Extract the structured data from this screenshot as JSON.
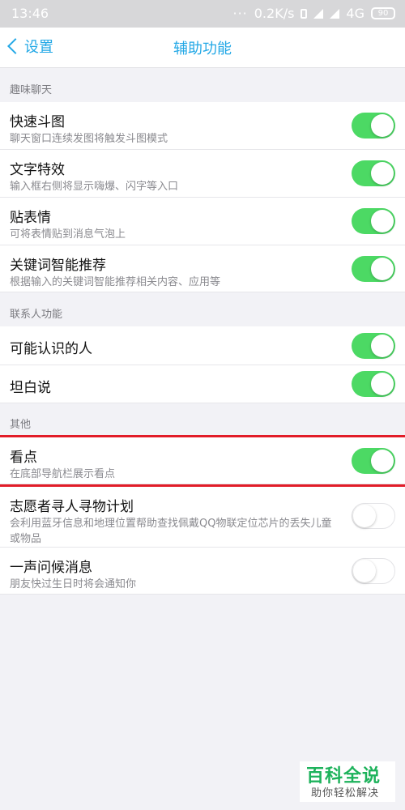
{
  "status": {
    "time": "13:46",
    "dots": "···",
    "speed": "0.2K/s",
    "network": "4G",
    "battery": "90"
  },
  "nav": {
    "back_label": "设置",
    "title": "辅助功能"
  },
  "sections": [
    {
      "header": "趣味聊天",
      "items": [
        {
          "title": "快速斗图",
          "subtitle": "聊天窗口连续发图将触发斗图模式",
          "on": true
        },
        {
          "title": "文字特效",
          "subtitle": "输入框右侧将显示嗨爆、闪字等入口",
          "on": true
        },
        {
          "title": "贴表情",
          "subtitle": "可将表情贴到消息气泡上",
          "on": true
        },
        {
          "title": "关键词智能推荐",
          "subtitle": "根据输入的关键词智能推荐相关内容、应用等",
          "on": true
        }
      ]
    },
    {
      "header": "联系人功能",
      "items": [
        {
          "title": "可能认识的人",
          "on": true
        },
        {
          "title": "坦白说",
          "on": true
        }
      ]
    },
    {
      "header": "其他",
      "items": [
        {
          "title": "看点",
          "subtitle": "在底部导航栏展示看点",
          "on": true
        },
        {
          "title": "志愿者寻人寻物计划",
          "subtitle": "会利用蓝牙信息和地理位置帮助查找佩戴QQ物联定位芯片的丢失儿童或物品",
          "on": false
        },
        {
          "title": "一声问候消息",
          "subtitle": "朋友快过生日时将会通知你",
          "on": false
        }
      ]
    }
  ],
  "watermark": {
    "line1": "百科全说",
    "line2": "助你轻松解决"
  },
  "colors": {
    "accent": "#23a8e6",
    "toggle_on": "#4cd964",
    "highlight": "#e21c28"
  }
}
